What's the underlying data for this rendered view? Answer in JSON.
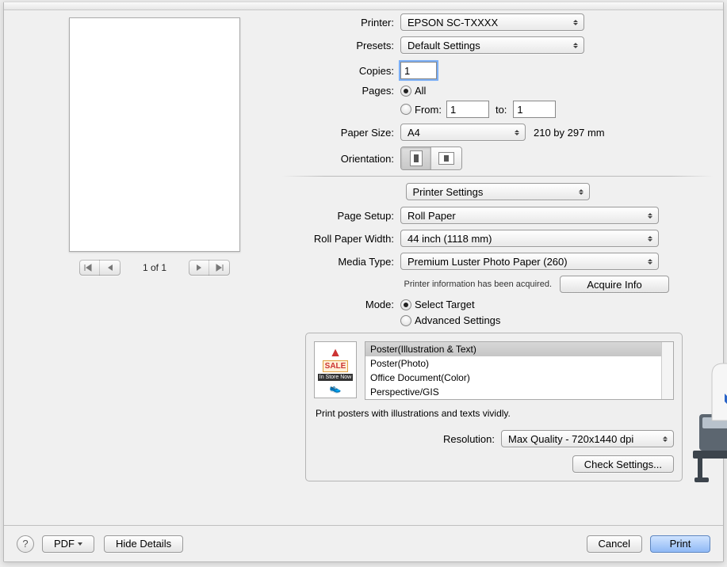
{
  "labels": {
    "printer": "Printer:",
    "presets": "Presets:",
    "copies": "Copies:",
    "pages": "Pages:",
    "from_lbl": "From:",
    "to_lbl": "to:",
    "paper_size": "Paper Size:",
    "orientation": "Orientation:",
    "page_setup": "Page Setup:",
    "roll_width": "Roll Paper Width:",
    "media_type": "Media Type:",
    "mode": "Mode:",
    "resolution": "Resolution:"
  },
  "values": {
    "printer": "EPSON SC-TXXXX",
    "presets": "Default Settings",
    "copies": "1",
    "pages_all": "All",
    "pages_from": "1",
    "pages_to": "1",
    "paper_size": "A4",
    "paper_dims": "210 by 297 mm",
    "section": "Printer Settings",
    "page_setup": "Roll Paper",
    "roll_width": "44 inch (1118 mm)",
    "media_type": "Premium Luster Photo Paper (260)",
    "printer_info_msg": "Printer information has been acquired.",
    "acquire_info": "Acquire Info",
    "mode_select": "Select Target",
    "mode_adv": "Advanced Settings",
    "resolution": "Max Quality - 720x1440 dpi",
    "check_settings": "Check Settings...",
    "page_of": "1 of 1",
    "pdf": "PDF",
    "hide_details": "Hide Details",
    "cancel": "Cancel",
    "print": "Print"
  },
  "thumb": {
    "sale": "SALE",
    "instore": "In Store Now"
  },
  "targets": [
    "Poster(Illustration & Text)",
    "Poster(Photo)",
    "Office Document(Color)",
    "Perspective/GIS"
  ],
  "target_desc": "Print posters with illustrations and texts vividly."
}
